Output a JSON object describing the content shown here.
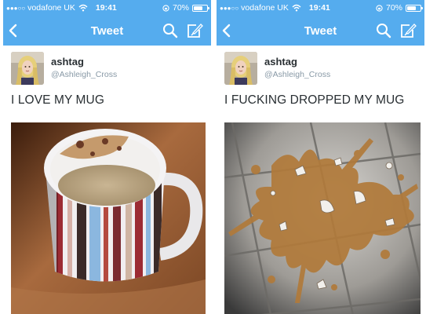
{
  "panels": [
    {
      "status": {
        "signal": "●●●○○",
        "carrier": "vodafone UK",
        "time": "19:41",
        "battery": "70%",
        "battery_fraction": 0.7
      },
      "nav": {
        "title": "Tweet"
      },
      "tweet": {
        "username": "ashtag",
        "handle": "@Ashleigh_Cross",
        "text": "I LOVE MY MUG"
      }
    },
    {
      "status": {
        "signal": "●●●○○",
        "carrier": "vodafone UK",
        "time": "19:41",
        "battery": "70%",
        "battery_fraction": 0.7
      },
      "nav": {
        "title": "Tweet"
      },
      "tweet": {
        "username": "ashtag",
        "handle": "@Ashleigh_Cross",
        "text": "I FUCKING DROPPED MY MUG"
      }
    }
  ],
  "colors": {
    "bar": "#55acee",
    "text": "#292f33",
    "handle": "#8899a6"
  },
  "icons": [
    "back-chevron-icon",
    "search-icon",
    "compose-icon",
    "wifi-icon",
    "lock-rotation-icon",
    "battery-icon"
  ]
}
